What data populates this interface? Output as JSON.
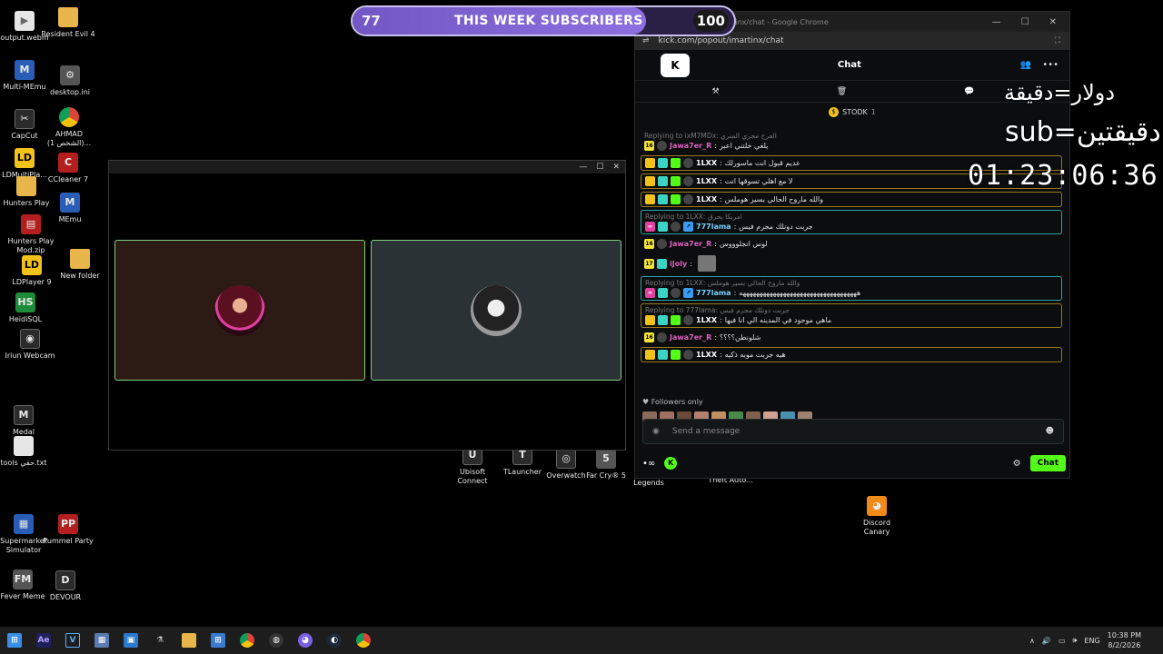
{
  "desktop_icons": {
    "output": "output.webm",
    "resident": "Resident Evil 4",
    "multimemu": "Multi-MEmu",
    "desktopini": "desktop.ini",
    "capcut": "CapCut",
    "ahmad": "AHMAD (الشخص 1)...",
    "ldmulti": "LDMultiPla...",
    "ccleaner": "CCleaner 7",
    "hunters": "Hunters Play",
    "memu": "MEmu",
    "huntersmod": "Hunters Play Mod.zip",
    "ldplayer": "LDPlayer 9",
    "newfolder": "New folder",
    "heidisql": "HeidiSQL",
    "iriun": "Iriun Webcam",
    "medal": "Medal",
    "tools": "tools حقي.txt",
    "supermarket": "Supermarket Simulator",
    "pummel": "Pummel Party",
    "fevermeme": "Fever Meme",
    "devour": "DEVOUR",
    "ubisoft": "Ubisoft Connect",
    "tlauncher": "TLauncher",
    "overwatch": "Overwatch",
    "farcry": "Far Cry® 5",
    "legends": "Legends",
    "theft": "Theft Auto...",
    "discord": "Discord Canary"
  },
  "sub_goal": {
    "current": "77",
    "title": "THIS WEEK SUBSCRIBERS",
    "target": "100",
    "progress": 0.77
  },
  "chrome": {
    "window_title": "kick.com/popout/imartinx/chat - Google Chrome",
    "url": "kick.com/popout/imartinx/chat"
  },
  "chat": {
    "logo": "K",
    "title": "Chat",
    "pinned_user": "STODK",
    "pinned_count": "1",
    "messages": [
      {
        "reply": "Replying to ixM7MDx: الفرح مجري المنري",
        "user": "Jawa7er_R",
        "text": "يلغي خلتني اعبر",
        "badge": "16"
      },
      {
        "reply": "",
        "user": "1LXX",
        "text": "عديم قبول انت ماسورلك"
      },
      {
        "reply": "",
        "user": "1LXX",
        "text": "لا مع اهلي تسوقها انت"
      },
      {
        "reply": "",
        "user": "1LXX",
        "text": "والله ماروح الحالي بسير هوملس"
      },
      {
        "reply": "Replying to 1LXX: امريكا يحرق",
        "user": "777lama",
        "text": "جربت دونلك مجرم فيس"
      },
      {
        "reply": "",
        "user": "Jawa7er_R",
        "text": "لوس انجلوووس",
        "badge": "16"
      },
      {
        "reply": "",
        "user": "iJoly",
        "text": "",
        "badge": "17"
      },
      {
        "reply": "Replying to 1LXX: والله ماروح الحالي بسير هوملس",
        "user": "777lama",
        "text": "هههههههههههههههههههههههههههههههههههه"
      },
      {
        "reply": "Replying to 777lama: جربت دونلك مجرم فيس",
        "user": "1LXX",
        "text": "ماهي موجود في المدينه الي انا فيها"
      },
      {
        "reply": "",
        "user": "Jawa7er_R",
        "text": "شلونطن؟؟؟؟",
        "badge": "16"
      },
      {
        "reply": "",
        "user": "1LXX",
        "text": "هيه جربت موبه ذكيه"
      }
    ],
    "followers_only": "Followers only",
    "input_placeholder": "Send a message",
    "chat_button": "Chat"
  },
  "overlay": {
    "line1": "دولار=دقيقة",
    "line2": "sub=دقيقتين",
    "timer": "01:23:06:36"
  },
  "taskbar": {
    "lang": "ENG",
    "time": "10:38 PM",
    "date": "8/2/2026"
  }
}
